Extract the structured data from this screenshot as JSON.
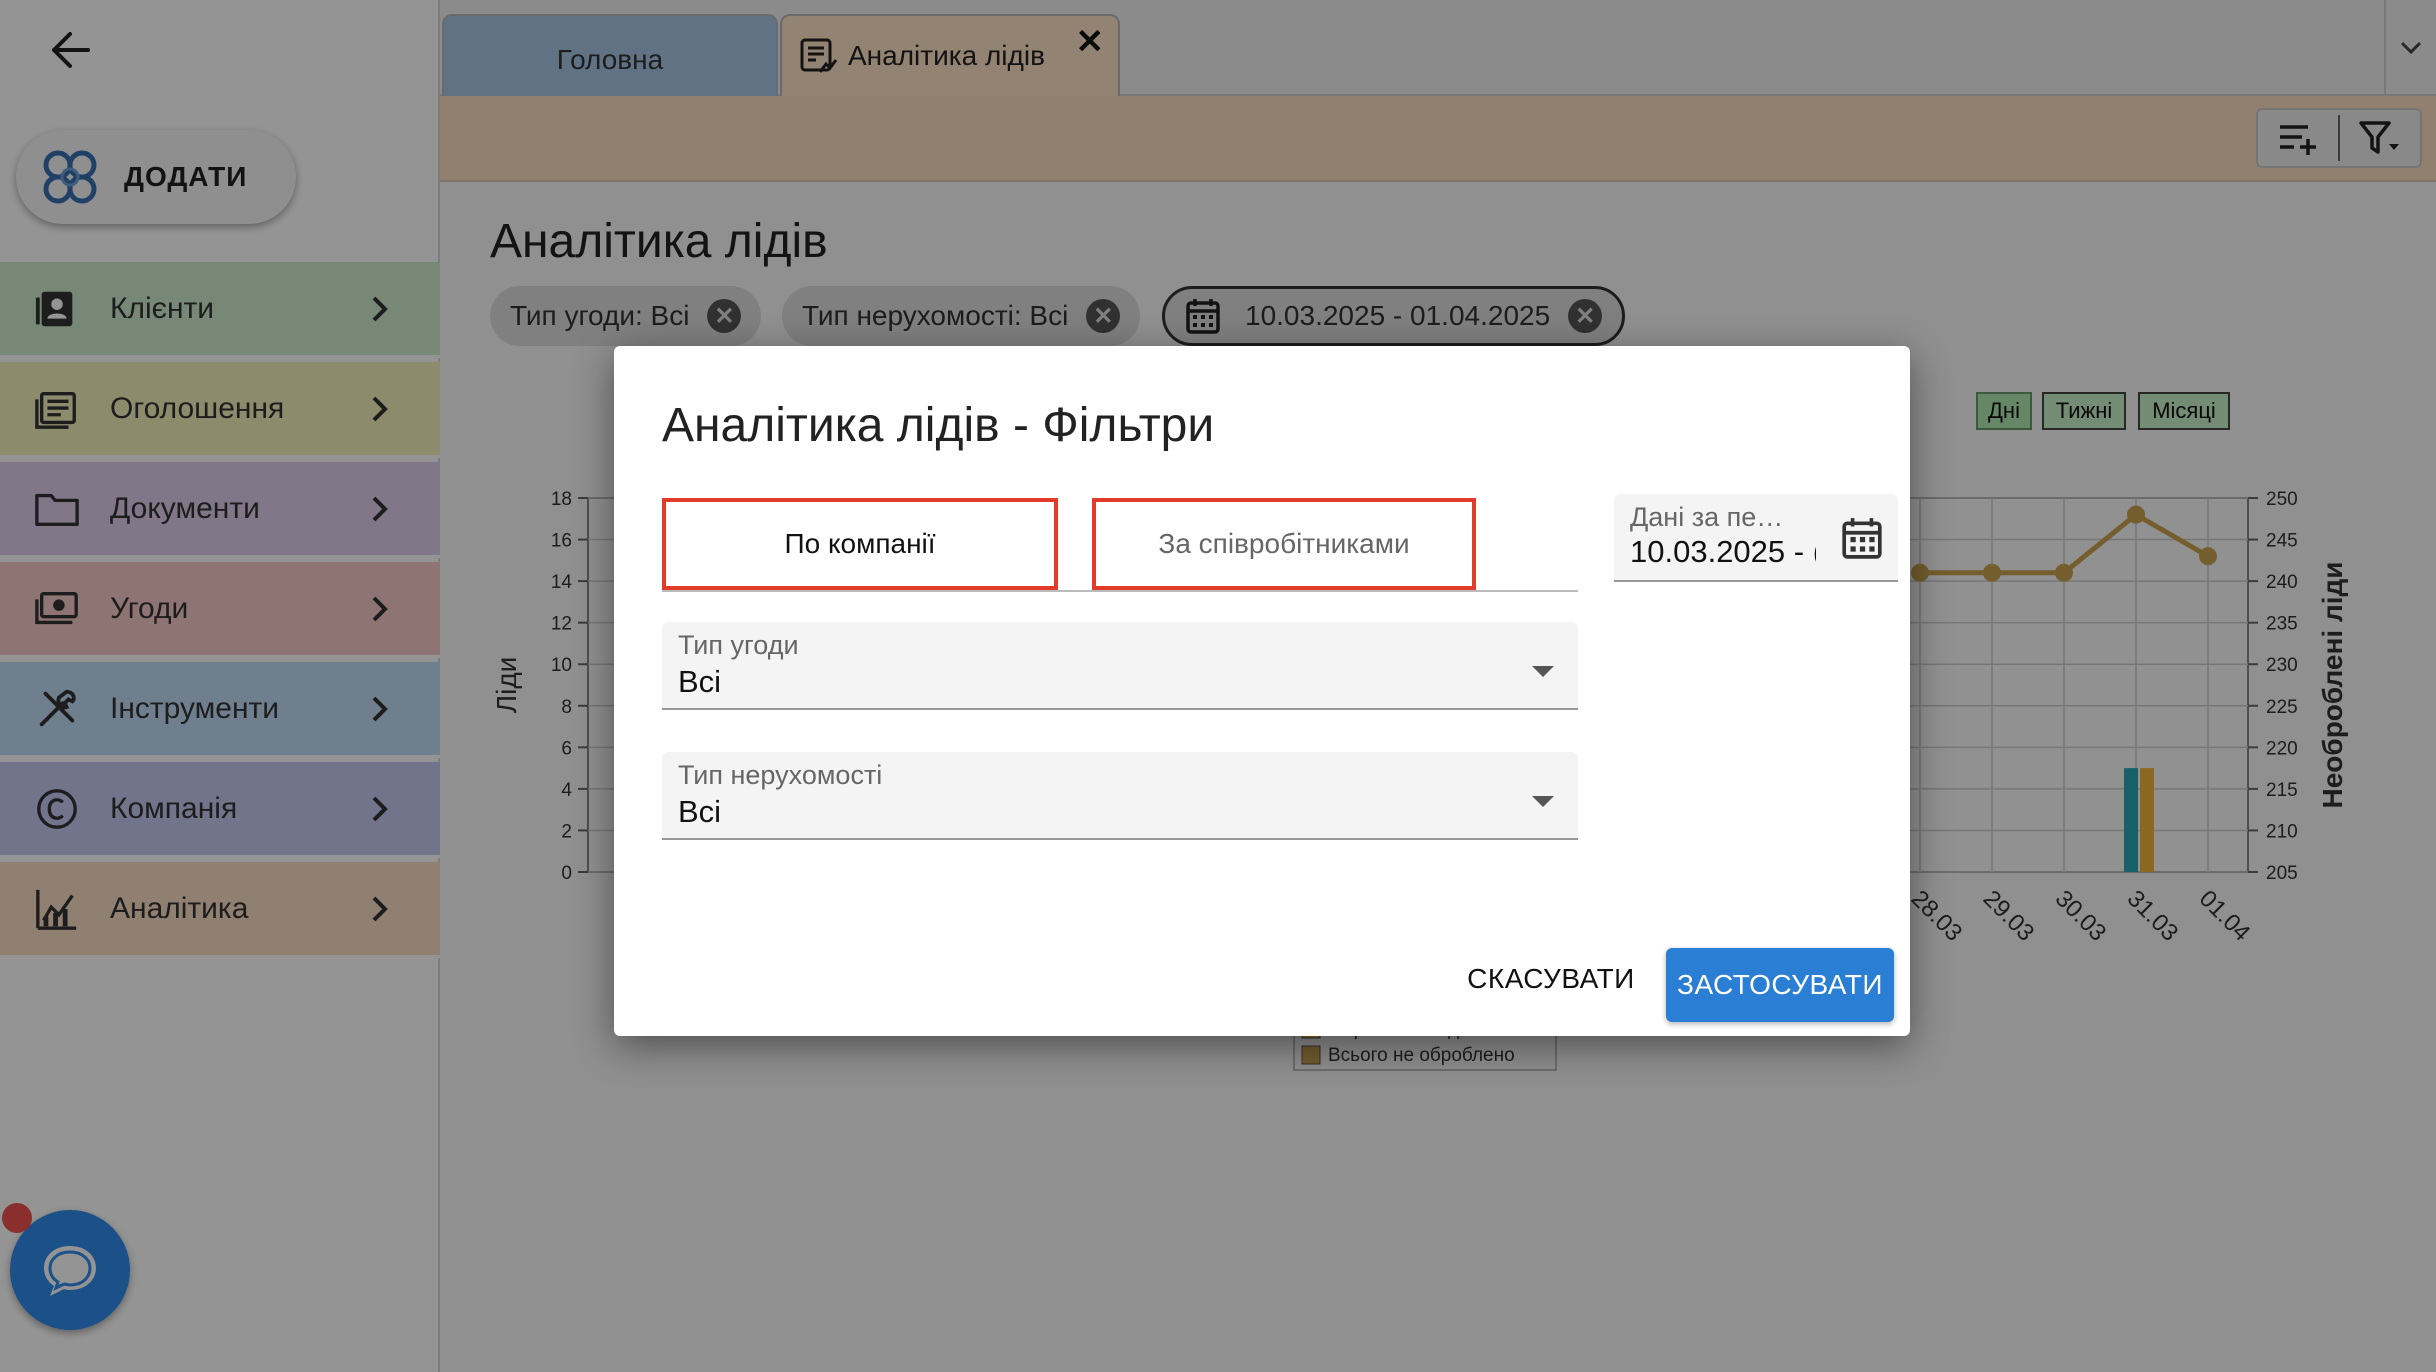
{
  "sidebar": {
    "add_label": "ДОДАТИ",
    "items": [
      {
        "label": "Клієнти",
        "icon": "contacts-icon",
        "color": "#cdebcd"
      },
      {
        "label": "Оголошення",
        "icon": "listings-icon",
        "color": "#f2f0b9"
      },
      {
        "label": "Документи",
        "icon": "folder-icon",
        "color": "#e0cdec"
      },
      {
        "label": "Угоди",
        "icon": "deals-icon",
        "color": "#f6c8c8"
      },
      {
        "label": "Інструменти",
        "icon": "tools-icon",
        "color": "#bfdbf3"
      },
      {
        "label": "Компанія",
        "icon": "copyright-icon",
        "color": "#c5c8f0"
      },
      {
        "label": "Аналітика",
        "icon": "analytics-icon",
        "color": "#f7dcc3"
      }
    ]
  },
  "tabs": [
    {
      "label": "Головна"
    },
    {
      "label": "Аналітика лідів"
    }
  ],
  "page": {
    "title": "Аналітика лідів",
    "chips": {
      "deal_type": "Тип угоди: Всі",
      "property_type": "Тип нерухомості: Всі",
      "date_range": "10.03.2025 - 01.04.2025"
    },
    "period_buttons": [
      "Дні",
      "Тижні",
      "Місяці"
    ]
  },
  "chart_data": {
    "type": "line",
    "ylabel": "Ліди",
    "y2label": "Необроблені ліди",
    "ylim": [
      0,
      18
    ],
    "y2lim": [
      205,
      250
    ],
    "y_ticks": [
      "0",
      "2",
      "4",
      "6",
      "8",
      "10",
      "12",
      "14",
      "16",
      "18"
    ],
    "y2_ticks": [
      "205",
      "210",
      "215",
      "220",
      "225",
      "230",
      "235",
      "240",
      "245",
      "250"
    ],
    "categories": [
      "28.03",
      "29.03",
      "30.03",
      "31.03",
      "01.04"
    ],
    "series": [
      {
        "name": "Всього не оброблено",
        "type": "line",
        "color": "#c9a34f",
        "values": [
          241,
          241,
          241,
          248,
          243
        ]
      }
    ],
    "bars": [
      {
        "category": "31.03",
        "values": [
          5,
          5
        ],
        "colors": [
          "#2aa5b5",
          "#f0b43c"
        ]
      }
    ],
    "legend": [
      "Оброблено лідів",
      "Всього не оброблено"
    ]
  },
  "modal": {
    "title": "Аналітика лідів - Фільтри",
    "seg_company": "По компанії",
    "seg_staff": "За співробітниками",
    "deal_label": "Тип угоди",
    "deal_value": "Всі",
    "prop_label": "Тип нерухомості",
    "prop_value": "Всі",
    "date_label": "Дані за пе…",
    "date_value": "10.03.2025 - (",
    "cancel": "СКАСУВАТИ",
    "apply": "ЗАСТОСУВАТИ"
  },
  "colors": {
    "accent": "#2a7fd4",
    "highlight": "#e23b2a"
  }
}
